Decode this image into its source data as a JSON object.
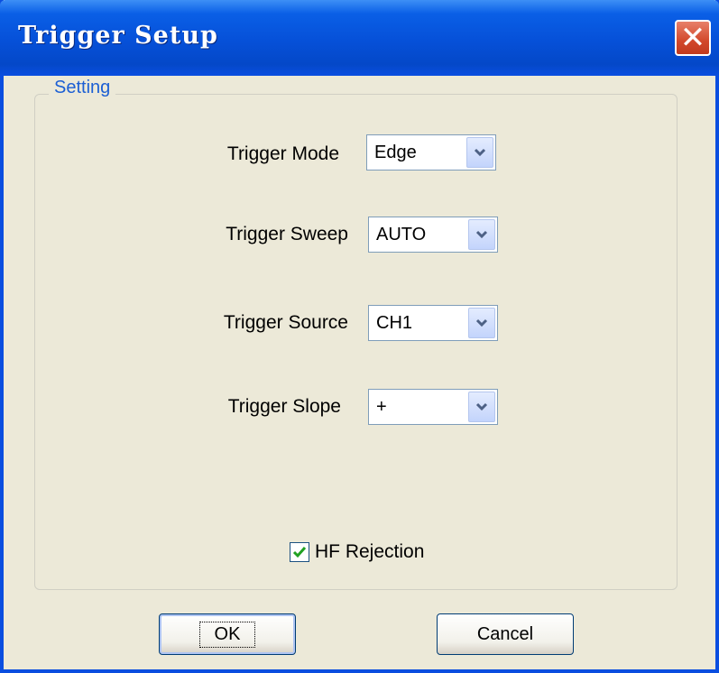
{
  "window": {
    "title": "Trigger Setup"
  },
  "group": {
    "label": "Setting"
  },
  "fields": {
    "mode": {
      "label": "Trigger Mode",
      "value": "Edge"
    },
    "sweep": {
      "label": "Trigger Sweep",
      "value": "AUTO"
    },
    "source": {
      "label": "Trigger Source",
      "value": "CH1"
    },
    "slope": {
      "label": "Trigger Slope",
      "value": "+"
    }
  },
  "hf_rejection": {
    "label": "HF Rejection",
    "checked": true
  },
  "buttons": {
    "ok": "OK",
    "cancel": "Cancel"
  },
  "icons": {
    "close": "close-icon",
    "dropdown": "chevron-down-icon",
    "check": "checkmark-icon"
  },
  "colors": {
    "titlebar": "#0650d8",
    "accent": "#1c5fd4",
    "close": "#d2482b",
    "check": "#21a121"
  }
}
